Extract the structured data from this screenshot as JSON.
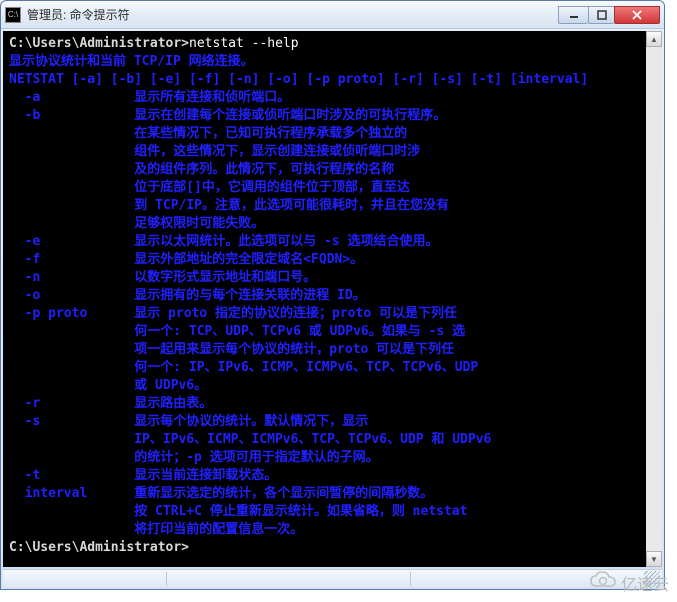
{
  "window": {
    "title": "管理员: 命令提示符",
    "icon_label": "C:\\"
  },
  "term": {
    "prompt1": "C:\\Users\\Administrator>",
    "command1": "netstat --help",
    "summary": "显示协议统计和当前 TCP/IP 网络连接。",
    "usage": "NETSTAT [-a] [-b] [-e] [-f] [-n] [-o] [-p proto] [-r] [-s] [-t] [interval]",
    "blank": "",
    "lines": [
      "  -a            显示所有连接和侦听端口。",
      "  -b            显示在创建每个连接或侦听端口时涉及的可执行程序。",
      "                在某些情况下，已知可执行程序承载多个独立的",
      "                组件，这些情况下，显示创建连接或侦听端口时涉",
      "                及的组件序列。此情况下，可执行程序的名称",
      "                位于底部[]中，它调用的组件位于顶部，直至达",
      "                到 TCP/IP。注意，此选项可能很耗时，并且在您没有",
      "                足够权限时可能失败。",
      "  -e            显示以太网统计。此选项可以与 -s 选项结合使用。",
      "  -f            显示外部地址的完全限定域名<FQDN>。",
      "  -n            以数字形式显示地址和端口号。",
      "  -o            显示拥有的与每个连接关联的进程 ID。",
      "  -p proto      显示 proto 指定的协议的连接；proto 可以是下列任",
      "                何一个: TCP、UDP、TCPv6 或 UDPv6。如果与 -s 选",
      "                项一起用来显示每个协议的统计，proto 可以是下列任",
      "                何一个: IP、IPv6、ICMP、ICMPv6、TCP、TCPv6、UDP",
      "                或 UDPv6。",
      "  -r            显示路由表。",
      "  -s            显示每个协议的统计。默认情况下，显示",
      "                IP、IPv6、ICMP、ICMPv6、TCP、TCPv6、UDP 和 UDPv6",
      "                的统计；-p 选项可用于指定默认的子网。",
      "  -t            显示当前连接卸载状态。",
      "  interval      重新显示选定的统计，各个显示间暂停的间隔秒数。",
      "                按 CTRL+C 停止重新显示统计。如果省略，则 netstat",
      "                将打印当前的配置信息一次。"
    ],
    "prompt2": "C:\\Users\\Administrator>"
  },
  "watermark": {
    "text": "亿速云"
  }
}
